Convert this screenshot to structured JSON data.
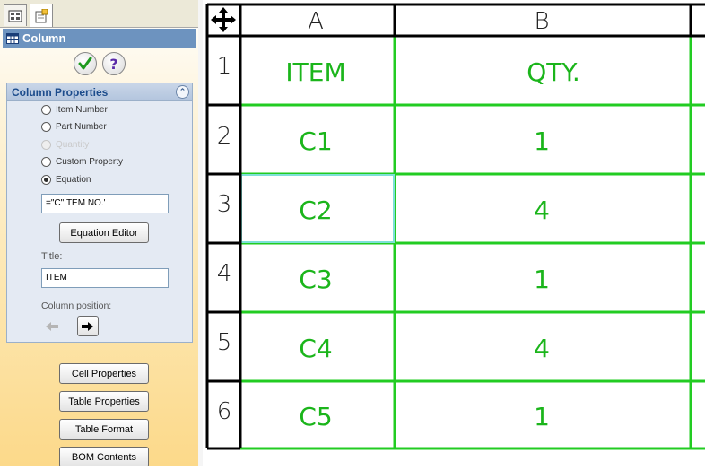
{
  "panel": {
    "header_title": "Column",
    "group_title": "Column Properties",
    "radio_options": [
      {
        "label": "Item Number",
        "checked": false,
        "disabled": false
      },
      {
        "label": "Part Number",
        "checked": false,
        "disabled": false
      },
      {
        "label": "Quantity",
        "checked": false,
        "disabled": true
      },
      {
        "label": "Custom Property",
        "checked": false,
        "disabled": false
      },
      {
        "label": "Equation",
        "checked": true,
        "disabled": false
      }
    ],
    "equation_value": "=\"C\"ITEM NO.'",
    "equation_editor_label": "Equation Editor",
    "title_label": "Title:",
    "title_value": "ITEM",
    "column_position_label": "Column position:",
    "buttons": {
      "cell_properties": "Cell Properties",
      "table_properties": "Table Properties",
      "table_format": "Table Format",
      "bom_contents": "BOM Contents"
    }
  },
  "table": {
    "column_headers": [
      "A",
      "B"
    ],
    "row_headers": [
      "1",
      "2",
      "3",
      "4",
      "5",
      "6"
    ],
    "rows": [
      [
        "ITEM",
        "QTY."
      ],
      [
        "C1",
        "1"
      ],
      [
        "C2",
        "4"
      ],
      [
        "C3",
        "1"
      ],
      [
        "C4",
        "4"
      ],
      [
        "C5",
        "1"
      ]
    ],
    "selected_cell": {
      "row": 2,
      "col": 0
    }
  },
  "colors": {
    "grid_green": "#22cc22",
    "text_green": "#1bb51b",
    "header_black": "#000000",
    "selected_cyan": "#7fe0d8",
    "panel_header_blue": "#6d93bf"
  },
  "icons": {
    "move_table": "move-arrows-icon",
    "ok": "checkmark-icon",
    "help": "question-icon",
    "move_left": "arrow-left-icon",
    "move_right": "arrow-right-icon"
  }
}
